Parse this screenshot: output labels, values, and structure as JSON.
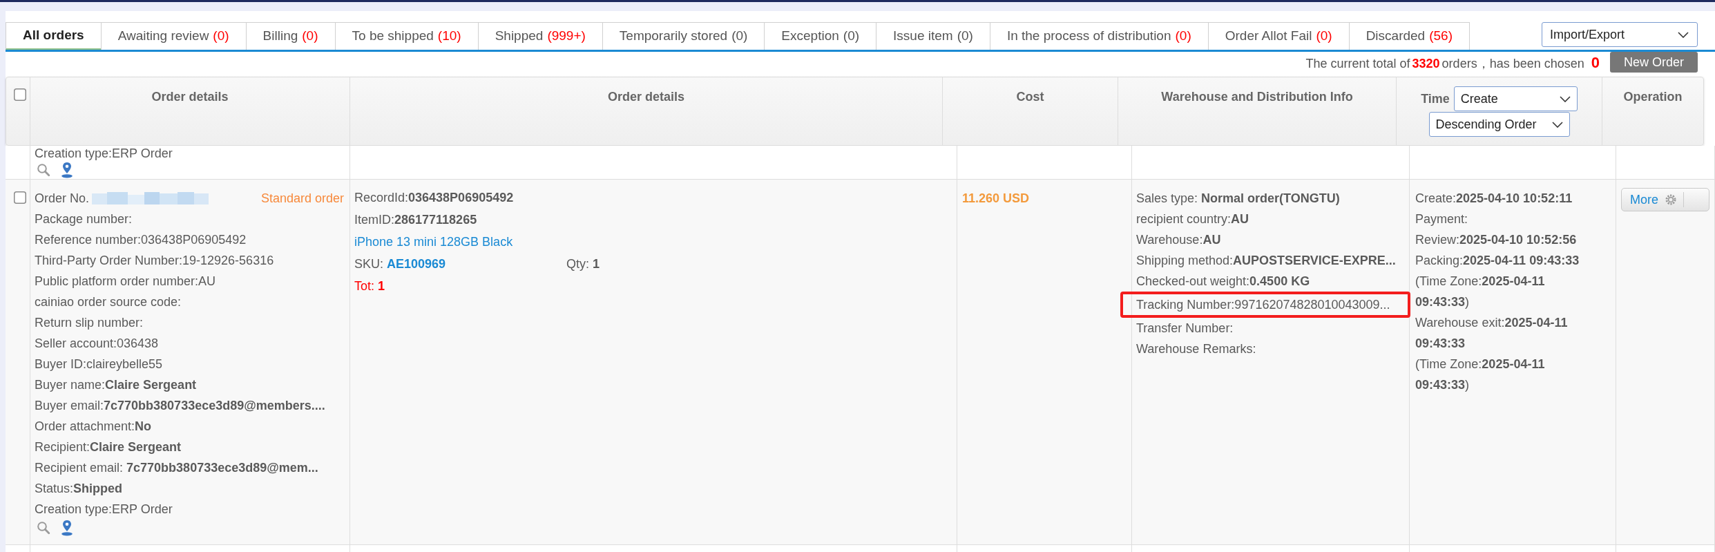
{
  "tabs": [
    {
      "label": "All orders",
      "selected": true
    },
    {
      "label": "Awaiting review",
      "count": "(0)",
      "count_highlighted": true,
      "selected": false
    },
    {
      "label": "Billing",
      "count": "(0)",
      "count_highlighted": true,
      "selected": false
    },
    {
      "label": "To be shipped",
      "count": "(10)",
      "count_highlighted": true,
      "selected": false
    },
    {
      "label": "Shipped",
      "count": "(999+)",
      "count_highlighted": true,
      "selected": false
    },
    {
      "label": "Temporarily stored",
      "count": "(0)",
      "count_highlighted": false,
      "selected": false
    },
    {
      "label": "Exception",
      "count": "(0)",
      "count_highlighted": false,
      "selected": false
    },
    {
      "label": "Issue item",
      "count": "(0)",
      "count_highlighted": false,
      "selected": false
    },
    {
      "label": "In the process of distribution",
      "count": "(0)",
      "count_highlighted": true,
      "selected": false
    },
    {
      "label": "Order Allot Fail",
      "count": "(0)",
      "count_highlighted": true,
      "selected": false
    },
    {
      "label": "Discarded",
      "count": "(56)",
      "count_highlighted": true,
      "selected": false
    }
  ],
  "import_export": {
    "value": "Import/Export"
  },
  "summary": {
    "before": "The current total of",
    "total": "3320",
    "after": "orders，has been chosen",
    "chosen": "0"
  },
  "new_order_button": {
    "label": "New Order"
  },
  "table": {
    "select_all": {
      "checked": false
    },
    "columns": [
      {
        "kind": "text",
        "label": "Order details"
      },
      {
        "kind": "text",
        "label": "Order details"
      },
      {
        "kind": "text",
        "label": "Cost"
      },
      {
        "kind": "text",
        "label": "Warehouse and Distribution Info"
      },
      {
        "kind": "sort",
        "label": "Time",
        "field": "Create",
        "order": "Descending Order"
      },
      {
        "kind": "text",
        "label": "Operation"
      }
    ],
    "rows": [
      {
        "kind": "partial",
        "details": [
          "Creation type:ERP Order"
        ]
      },
      {
        "kind": "order",
        "checked": false,
        "order_no_label": "Order No.",
        "order_type": "Standard order",
        "details": [
          "Package number:",
          "Reference number:036438P06905492",
          "Third-Party Order Number:19-12926-56316",
          "Public platform order number:AU",
          "cainiao order source code:",
          "Return slip number:",
          "Seller account:036438",
          "Buyer ID:claireybelle55",
          "Buyer name:**Claire Sergeant**",
          "Buyer email:**7c770bb380733ece3d89@members....**",
          "Order attachment:**No**",
          "Recipient:**Claire Sergeant**",
          "Recipient email: **7c770bb380733ece3d89@mem...**",
          "Status:**Shipped**",
          "Creation type:ERP Order"
        ],
        "item": {
          "record_id": "RecordId:**036438P06905492**",
          "item_id": "ItemID:**286177118265**",
          "title": "iPhone 13 mini 128GB Black",
          "sku_label": "SKU:",
          "sku": "AE100969",
          "qty": "Qty: **1**",
          "total": "Tot: **1**"
        },
        "cost": "11.260 USD",
        "warehouse": [
          {
            "text": "Sales type: **Normal order(TONGTU)**",
            "highlighted": false
          },
          {
            "text": "recipient country:**AU**",
            "highlighted": false
          },
          {
            "text": "Warehouse:**AU**",
            "highlighted": false
          },
          {
            "text": "Shipping method:**AUPOSTSERVICE-EXPRE...**",
            "highlighted": false
          },
          {
            "text": "Checked-out weight:**0.4500 KG**",
            "highlighted": false
          },
          {
            "text": "Tracking Number:997162074828010043009...",
            "highlighted": true
          },
          {
            "text": "Transfer Number:",
            "highlighted": false
          },
          {
            "text": "Warehouse Remarks:",
            "highlighted": false
          }
        ],
        "times": [
          "Create:**2025-04-10 10:52:11**",
          "Payment:",
          "Review:**2025-04-10 10:52:56**",
          "Packing:**2025-04-11 09:43:33**",
          "(Time Zone:**2025-04-11 09:43:33**)",
          "Warehouse exit:**2025-04-11 09:43:33**",
          "(Time Zone:**2025-04-11 09:43:33**)"
        ],
        "operation": {
          "label": "More"
        }
      }
    ]
  }
}
